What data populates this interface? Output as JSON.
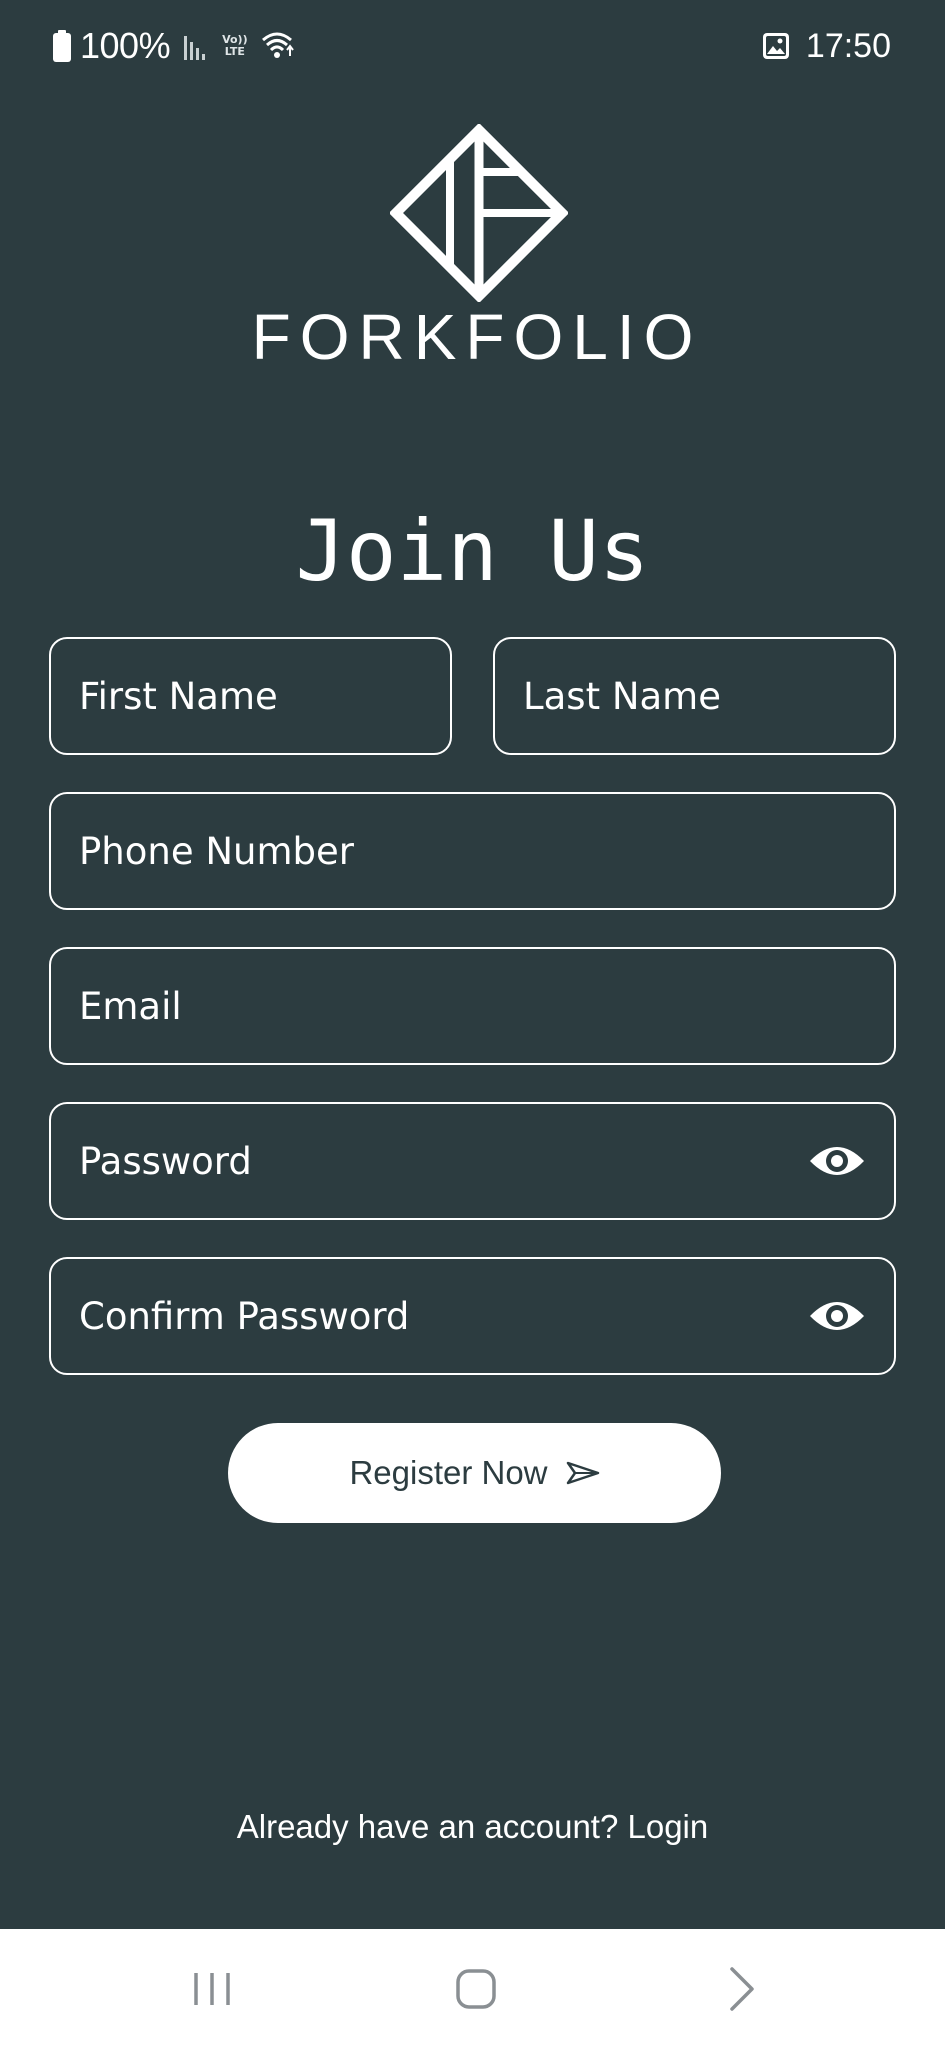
{
  "status_bar": {
    "battery": "100%",
    "network": "LTE",
    "volte": "Vo))",
    "time": "17:50",
    "icons": [
      "battery-icon",
      "signal-icon",
      "volte-lte-icon",
      "wifi-icon",
      "gallery-icon"
    ]
  },
  "brand": {
    "name": "FORKFOLIO",
    "logo_icon": "forkfolio-diamond-logo"
  },
  "form": {
    "title": "Join Us",
    "fields": {
      "first_name": {
        "placeholder": "First Name",
        "value": ""
      },
      "last_name": {
        "placeholder": "Last Name",
        "value": ""
      },
      "phone": {
        "placeholder": "Phone Number",
        "value": ""
      },
      "email": {
        "placeholder": "Email",
        "value": ""
      },
      "password": {
        "placeholder": "Password",
        "value": "",
        "toggle_icon": "eye-icon"
      },
      "confirm_password": {
        "placeholder": "Confirm Password",
        "value": "",
        "toggle_icon": "eye-icon"
      }
    },
    "submit_label": "Register Now",
    "submit_icon": "send-arrow-icon"
  },
  "footer": {
    "login_prompt": "Already have an account? Login"
  },
  "nav_bar": {
    "buttons": [
      "recent-apps-icon",
      "home-icon",
      "back-icon"
    ]
  },
  "colors": {
    "background": "#2c3c40",
    "foreground": "#ffffff",
    "nav_bar": "#ffffff",
    "nav_icons": "#8a8f93"
  }
}
